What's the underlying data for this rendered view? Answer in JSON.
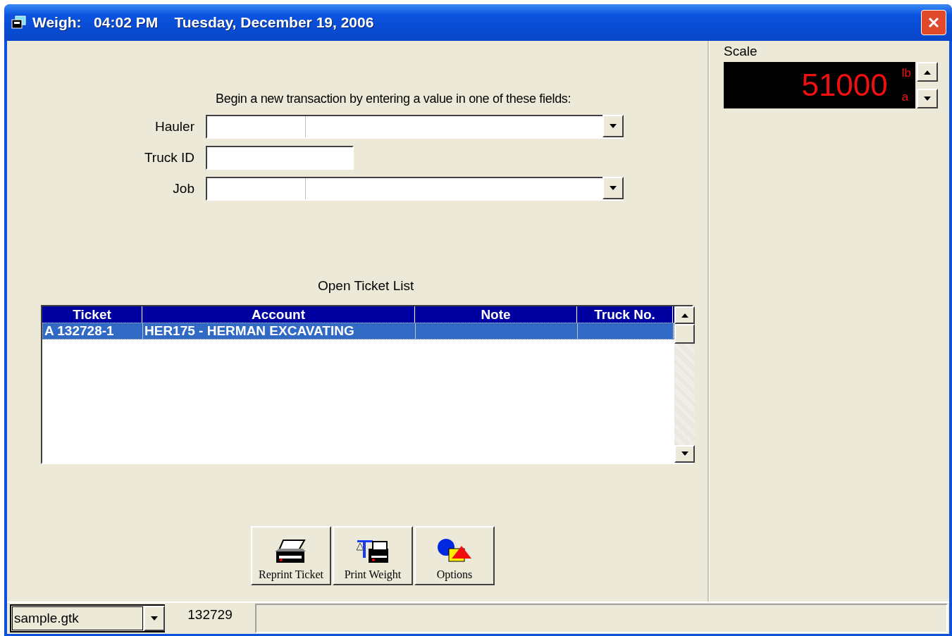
{
  "window": {
    "title": "Weigh:   04:02 PM    Tuesday, December 19, 2006"
  },
  "form": {
    "prompt": "Begin a new transaction by entering a value in one of these fields:",
    "fields": [
      {
        "kind": "combo",
        "label": "Hauler"
      },
      {
        "kind": "text",
        "label": "Truck ID"
      },
      {
        "kind": "combo",
        "label": "Job"
      }
    ]
  },
  "ticket_list": {
    "title": "Open Ticket List",
    "columns": [
      "Ticket",
      "Account",
      "Note",
      "Truck No."
    ],
    "rows": [
      {
        "cells": [
          "A 132728-1",
          "HER175 - HERMAN EXCAVATING",
          "",
          ""
        ],
        "selected": true
      }
    ]
  },
  "buttons": [
    {
      "kind": "printer",
      "label": "Reprint Ticket"
    },
    {
      "kind": "scale",
      "label": "Print Weight"
    },
    {
      "kind": "shapes",
      "label": "Options"
    }
  ],
  "scale": {
    "label": "Scale",
    "reading": "51000",
    "unit": "lb",
    "mode": "a"
  },
  "status_bar": {
    "file": "sample.gtk",
    "ticket_number": "132729"
  }
}
